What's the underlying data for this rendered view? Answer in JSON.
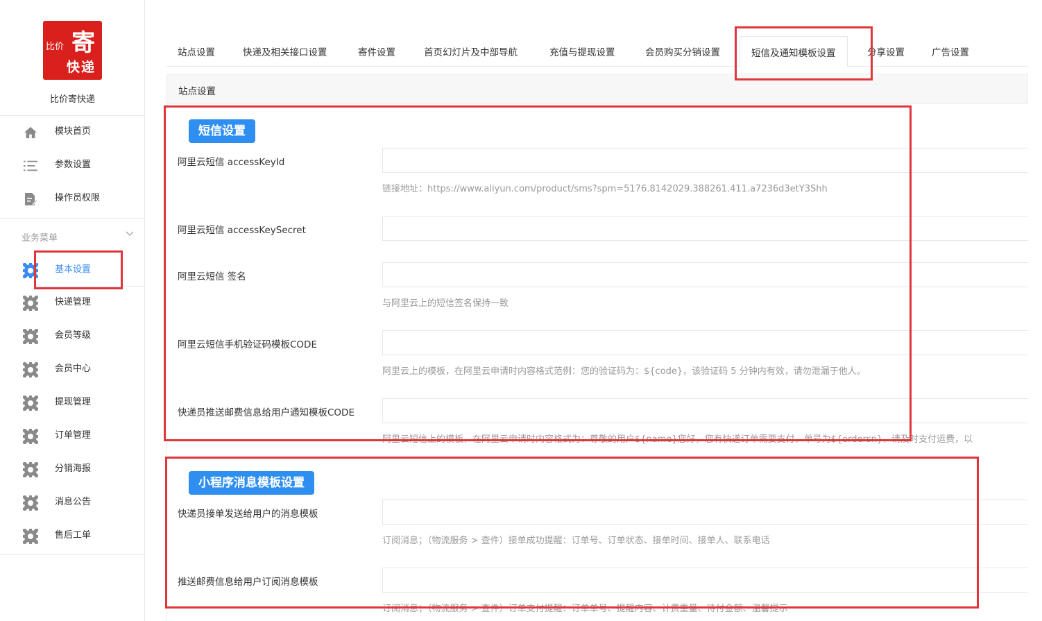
{
  "sidebar": {
    "logo": {
      "line1": "比价",
      "line2": "寄",
      "line3": "快递"
    },
    "brand": "比价寄快递",
    "top_items": [
      {
        "label": "模块首页",
        "icon": "home-icon"
      },
      {
        "label": "参数设置",
        "icon": "list-icon"
      },
      {
        "label": "操作员权限",
        "icon": "edit-document-icon"
      }
    ],
    "menu_header": "业务菜单",
    "menu_items": [
      {
        "label": "基本设置",
        "icon": "gear-icon",
        "active": true
      },
      {
        "label": "快递管理",
        "icon": "gear-icon"
      },
      {
        "label": "会员等级",
        "icon": "gear-icon"
      },
      {
        "label": "会员中心",
        "icon": "gear-icon"
      },
      {
        "label": "提现管理",
        "icon": "gear-icon"
      },
      {
        "label": "订单管理",
        "icon": "gear-icon"
      },
      {
        "label": "分销海报",
        "icon": "gear-icon"
      },
      {
        "label": "消息公告",
        "icon": "gear-icon"
      },
      {
        "label": "售后工单",
        "icon": "gear-icon"
      }
    ]
  },
  "tabs": [
    {
      "label": "站点设置"
    },
    {
      "label": "快递及相关接口设置"
    },
    {
      "label": "寄件设置"
    },
    {
      "label": "首页幻灯片及中部导航"
    },
    {
      "label": "充值与提现设置"
    },
    {
      "label": "会员购买分销设置"
    },
    {
      "label": "短信及通知模板设置",
      "active": true
    },
    {
      "label": "分享设置"
    },
    {
      "label": "广告设置"
    }
  ],
  "panel_title": "站点设置",
  "sms_section": {
    "title": "短信设置",
    "fields": [
      {
        "label": "阿里云短信 accessKeyId",
        "value": "",
        "help": "链接地址：https://www.aliyun.com/product/sms?spm=5176.8142029.388261.411.a7236d3etY3Shh"
      },
      {
        "label": "阿里云短信 accessKeySecret",
        "value": "",
        "help": ""
      },
      {
        "label": "阿里云短信 签名",
        "value": "",
        "help": "与阿里云上的短信签名保持一致"
      },
      {
        "label": "阿里云短信手机验证码模板CODE",
        "value": "",
        "help": "阿里云上的模板，在阿里云申请时内容格式范例：您的验证码为：${code}，该验证码 5 分钟内有效，请勿泄漏于他人。"
      },
      {
        "label": "快递员推送邮费信息给用户通知模板CODE",
        "value": "",
        "help": "阿里云短信上的模板，在阿里云申请时内容格式为：尊敬的用户${name}您好，您有快递订单需要支付，单号为${ordersn}，请及时支付运费，以"
      }
    ]
  },
  "mini_section": {
    "title": "小程序消息模板设置",
    "fields": [
      {
        "label": "快递员接单发送给用户的消息模板",
        "value": "",
        "help": "订阅消息；（物流服务 > 查件）接单成功提醒：订单号、订单状态、接单时间、接单人、联系电话"
      },
      {
        "label": "推送邮费信息给用户订阅消息模板",
        "value": "",
        "help": "订阅消息；（物流服务 > 查件）订单支付提醒：订单单号、提醒内容、计费重量、待付金额、温馨提示"
      }
    ]
  },
  "colors": {
    "accent": "#2f8ff0",
    "highlight": "#e0353b",
    "logo_bg": "#d9201c"
  }
}
